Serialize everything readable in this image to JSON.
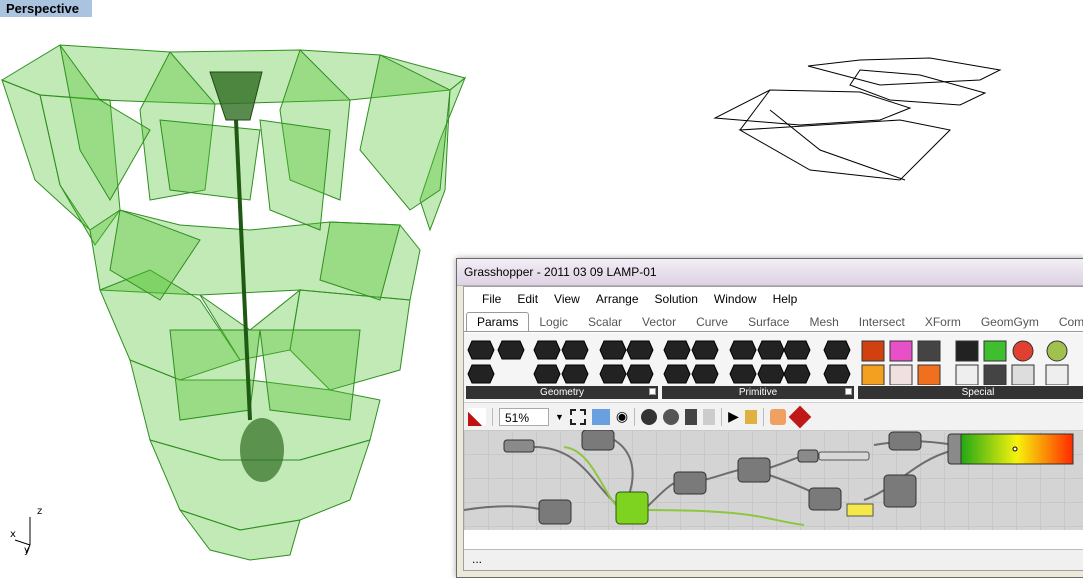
{
  "viewport": {
    "label": "Perspective"
  },
  "axes": {
    "x": "x",
    "y": "y",
    "z": "z"
  },
  "gh": {
    "title": "Grasshopper - 2011 03 09 LAMP-01",
    "menu": [
      "File",
      "Edit",
      "View",
      "Arrange",
      "Solution",
      "Window",
      "Help"
    ],
    "tabs": [
      "Params",
      "Logic",
      "Scalar",
      "Vector",
      "Curve",
      "Surface",
      "Mesh",
      "Intersect",
      "XForm",
      "GeomGym",
      "Compl"
    ],
    "active_tab": "Params",
    "panels": [
      "Geometry",
      "Primitive",
      "Special"
    ],
    "zoom": "51%",
    "status": "...",
    "colors": {
      "node_green": "#7ed321",
      "gradient_start": "#ff2a00",
      "gradient_mid": "#f7f20c",
      "gradient_end": "#22a815",
      "lamp_green": "#4fc32d"
    }
  }
}
